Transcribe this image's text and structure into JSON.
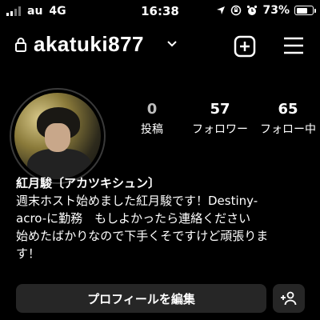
{
  "status_bar": {
    "carrier": "au",
    "network": "4G",
    "time": "16:38",
    "battery_percent": "73%",
    "battery_level": 0.73,
    "icons": [
      "location-arrow-icon",
      "rotation-lock-icon",
      "alarm-icon"
    ]
  },
  "header": {
    "username": "akatuki877",
    "icons": [
      "lock-icon",
      "chevron-down-icon",
      "new-post-icon",
      "menu-icon"
    ]
  },
  "profile": {
    "stats": [
      {
        "value": "0",
        "label": "投稿"
      },
      {
        "value": "57",
        "label": "フォロワー"
      },
      {
        "value": "65",
        "label": "フォロー中"
      }
    ],
    "name": "紅月駿〔アカツキシュン〕",
    "bio": "週末ホスト始めました紅月駿です！Destiny-\nacro-に勤務　もしよかったら連絡ください\n始めたばかりなので下手くそですけど頑張りま\nす！"
  },
  "actions": {
    "edit_profile": "プロフィールを編集",
    "discover_people_icon": "add-person-icon"
  },
  "colors": {
    "background": "#000000",
    "button": "#262626",
    "muted_text": "#bdbdbd"
  }
}
